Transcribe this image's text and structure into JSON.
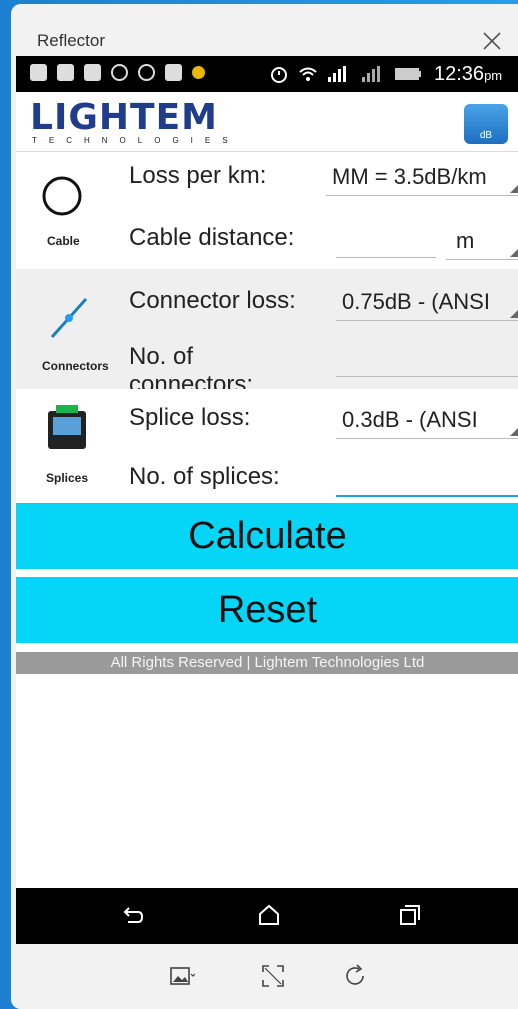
{
  "window": {
    "title": "Reflector"
  },
  "status_bar": {
    "time": "12:36",
    "ampm": "pm"
  },
  "header": {
    "logo": "LIGHTEM",
    "logo_sub": "TECHNOLOGIES",
    "app_icon_label": "dB"
  },
  "cable": {
    "section_label": "Cable",
    "loss_label": "Loss per km:",
    "loss_value": "MM = 3.5dB/km",
    "distance_label": "Cable distance:",
    "distance_value": "",
    "distance_unit": "m"
  },
  "connectors": {
    "section_label": "Connectors",
    "loss_label": "Connector loss:",
    "loss_value": "0.75dB - (ANSI",
    "count_label": "No. of connectors:",
    "count_value": ""
  },
  "splices": {
    "section_label": "Splices",
    "loss_label": "Splice loss:",
    "loss_value": "0.3dB - (ANSI",
    "count_label": "No. of splices:",
    "count_value": ""
  },
  "buttons": {
    "calculate": "Calculate",
    "reset": "Reset"
  },
  "footer": {
    "text": "All Rights Reserved | Lightem Technologies Ltd"
  },
  "nav_icons": [
    "back-icon",
    "home-icon",
    "recents-icon"
  ],
  "tool_icons": [
    "crop-icon",
    "expand-icon",
    "rotate-icon"
  ],
  "colors": {
    "accent_button": "#05d6f7",
    "brand_blue": "#1f3d8a",
    "footer_bg": "#9a9a9a"
  }
}
